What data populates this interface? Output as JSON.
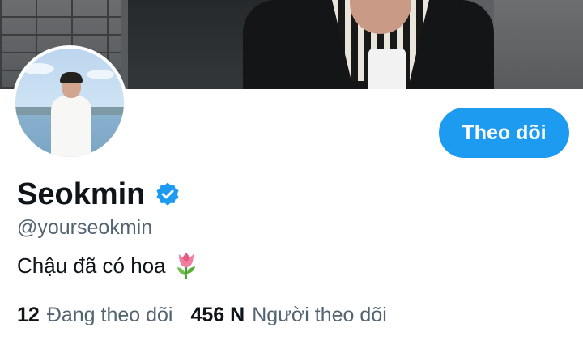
{
  "profile": {
    "display_name": "Seokmin",
    "handle": "@yourseokmin",
    "bio": "Chậu đã có hoa",
    "bio_emoji": "tulip-emoji",
    "verified": true
  },
  "actions": {
    "follow_label": "Theo dõi"
  },
  "stats": {
    "following_count": "12",
    "following_label": "Đang theo dõi",
    "followers_count": "456 N",
    "followers_label": "Người theo dõi"
  },
  "colors": {
    "accent": "#1d9bf0",
    "text_primary": "#0f1419",
    "text_secondary": "#536471",
    "background": "#ffffff"
  },
  "icons": {
    "verified": "verified-badge-icon",
    "emoji": "tulip-icon"
  }
}
